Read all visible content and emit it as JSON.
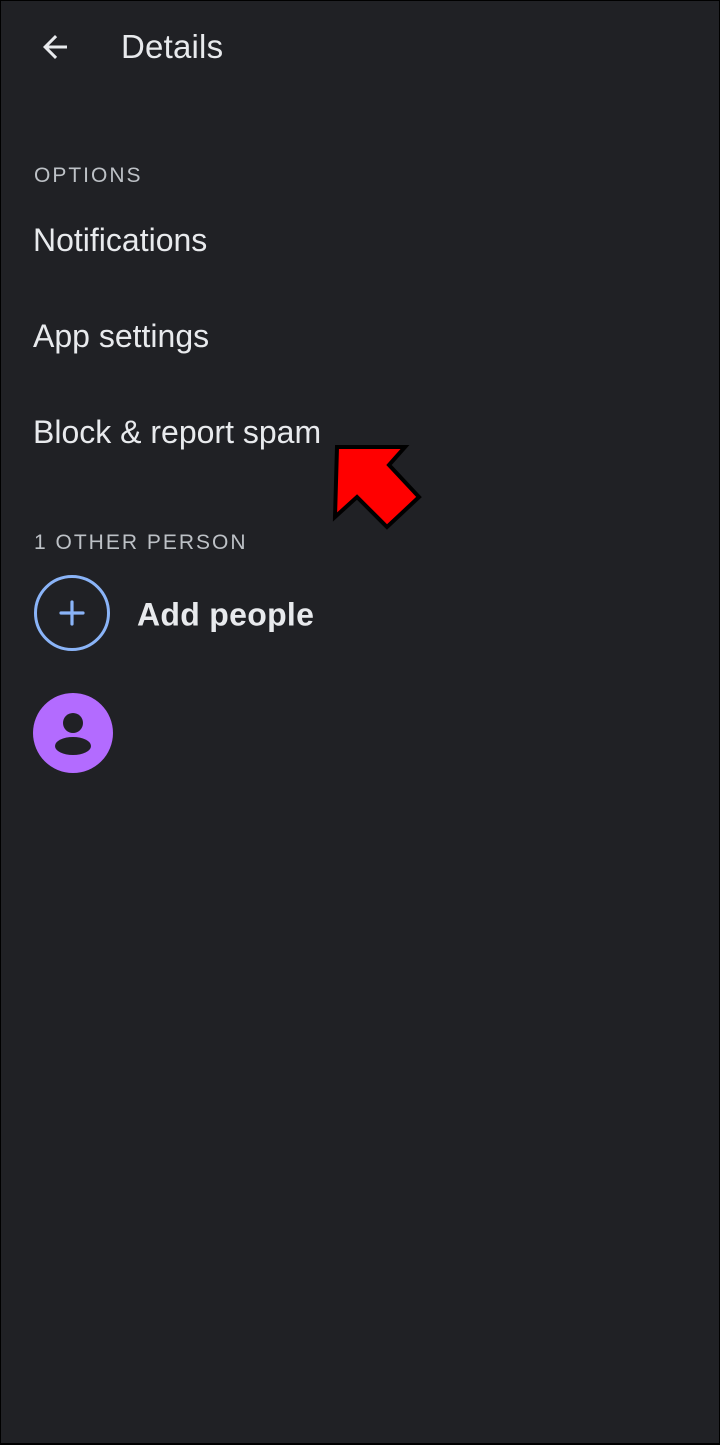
{
  "header": {
    "title": "Details",
    "back_icon": "arrow-back-icon"
  },
  "options_section": {
    "header": "OPTIONS",
    "items": [
      {
        "label": "Notifications"
      },
      {
        "label": "App settings"
      },
      {
        "label": "Block & report spam"
      }
    ]
  },
  "people_section": {
    "header": "1 OTHER PERSON",
    "add_people": {
      "label": "Add people",
      "icon": "add-icon"
    },
    "contacts": [
      {
        "avatar_icon": "person-icon",
        "avatar_color": "#b36bff"
      }
    ]
  },
  "annotation": {
    "icon": "arrow-pointer-icon",
    "color": "#ff0000"
  },
  "colors": {
    "background": "#202125",
    "text_primary": "#e8eaed",
    "text_secondary": "#bdc1c6",
    "accent_blue": "#8ab4f8"
  }
}
